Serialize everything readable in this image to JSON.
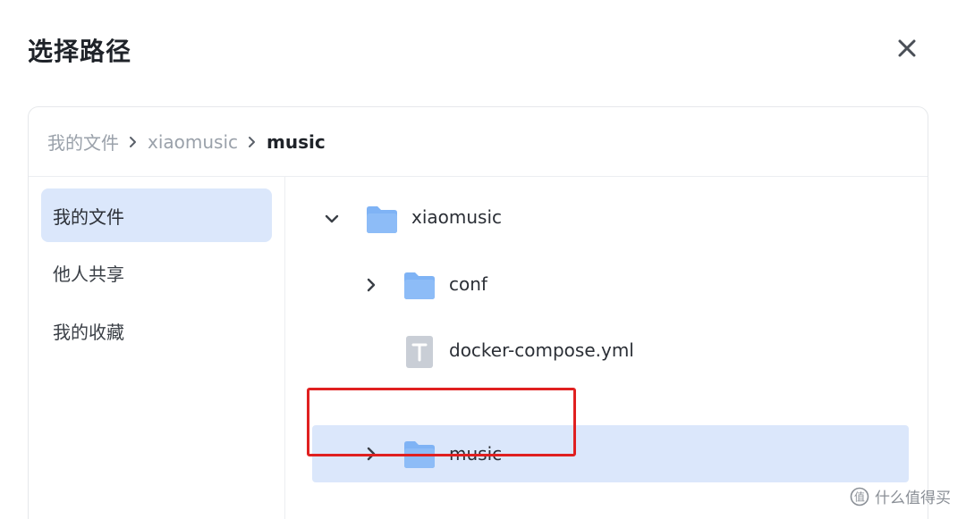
{
  "dialog": {
    "title": "选择路径"
  },
  "breadcrumb": [
    "我的文件",
    "xiaomusic",
    "music"
  ],
  "sidebar": {
    "items": [
      "我的文件",
      "他人共享",
      "我的收藏"
    ],
    "active_index": 0
  },
  "tree": {
    "rows": [
      {
        "name": "xiaomusic",
        "type": "folder",
        "expanded": true
      },
      {
        "name": "conf",
        "type": "folder",
        "expanded": false
      },
      {
        "name": "docker-compose.yml",
        "type": "file"
      },
      {
        "name": "music",
        "type": "folder",
        "expanded": false,
        "selected": true
      }
    ]
  },
  "icons": {
    "close": "close-icon",
    "folder": "folder-icon",
    "file": "text-file-icon",
    "chevron": "chevron-icon"
  },
  "colors": {
    "folder": "#7fb3f5",
    "selection": "#dbe7fb",
    "highlight_box": "#e02020"
  },
  "watermark": {
    "text": "什么值得买"
  }
}
